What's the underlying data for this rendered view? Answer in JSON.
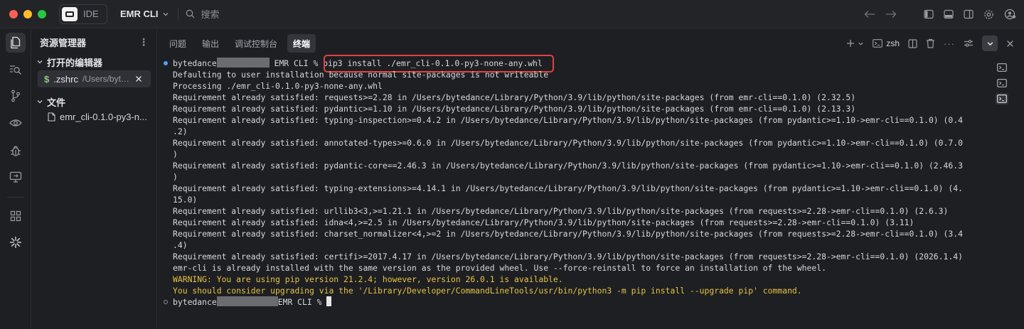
{
  "titlebar": {
    "app_label": "IDE",
    "project_name": "EMR CLI",
    "search_placeholder": "搜索"
  },
  "sidebar": {
    "title": "资源管理器",
    "open_editors_label": "打开的编辑器",
    "open_editor": {
      "name": ".zshrc",
      "path": "/Users/byt…"
    },
    "files_label": "文件",
    "files": [
      {
        "name": "emr_cli-0.1.0-py3-n..."
      }
    ]
  },
  "panel": {
    "tabs": [
      {
        "label": "问题",
        "active": false
      },
      {
        "label": "输出",
        "active": false
      },
      {
        "label": "调试控制台",
        "active": false
      },
      {
        "label": "终端",
        "active": true
      }
    ],
    "shell_label": "zsh"
  },
  "terminal": {
    "prompt_user": "bytedance",
    "prompt_suffix": " EMR CLI % ",
    "command": "pip3 install ./emr_cli-0.1.0-py3-none-any.whl",
    "output": [
      "Defaulting to user installation because normal site-packages is not writeable",
      "Processing ./emr_cli-0.1.0-py3-none-any.whl",
      "Requirement already satisfied: requests>=2.28 in /Users/bytedance/Library/Python/3.9/lib/python/site-packages (from emr-cli==0.1.0) (2.32.5)",
      "Requirement already satisfied: pydantic>=1.10 in /Users/bytedance/Library/Python/3.9/lib/python/site-packages (from emr-cli==0.1.0) (2.13.3)",
      "Requirement already satisfied: typing-inspection>=0.4.2 in /Users/bytedance/Library/Python/3.9/lib/python/site-packages (from pydantic>=1.10->emr-cli==0.1.0) (0.4",
      ".2)",
      "Requirement already satisfied: annotated-types>=0.6.0 in /Users/bytedance/Library/Python/3.9/lib/python/site-packages (from pydantic>=1.10->emr-cli==0.1.0) (0.7.0",
      ")",
      "Requirement already satisfied: pydantic-core==2.46.3 in /Users/bytedance/Library/Python/3.9/lib/python/site-packages (from pydantic>=1.10->emr-cli==0.1.0) (2.46.3",
      ")",
      "Requirement already satisfied: typing-extensions>=4.14.1 in /Users/bytedance/Library/Python/3.9/lib/python/site-packages (from pydantic>=1.10->emr-cli==0.1.0) (4.",
      "15.0)",
      "Requirement already satisfied: urllib3<3,>=1.21.1 in /Users/bytedance/Library/Python/3.9/lib/python/site-packages (from requests>=2.28->emr-cli==0.1.0) (2.6.3)",
      "Requirement already satisfied: idna<4,>=2.5 in /Users/bytedance/Library/Python/3.9/lib/python/site-packages (from requests>=2.28->emr-cli==0.1.0) (3.11)",
      "Requirement already satisfied: charset_normalizer<4,>=2 in /Users/bytedance/Library/Python/3.9/lib/python/site-packages (from requests>=2.28->emr-cli==0.1.0) (3.4",
      ".4)",
      "Requirement already satisfied: certifi>=2017.4.17 in /Users/bytedance/Library/Python/3.9/lib/python/site-packages (from requests>=2.28->emr-cli==0.1.0) (2026.1.4)",
      "emr-cli is already installed with the same version as the provided wheel. Use --force-reinstall to force an installation of the wheel."
    ],
    "warnings": [
      "WARNING: You are using pip version 21.2.4; however, version 26.0.1 is available.",
      "You should consider upgrading via the '/Library/Developer/CommandLineTools/usr/bin/python3 -m pip install --upgrade pip' command."
    ],
    "final_prompt_user": "bytedance",
    "final_prompt_suffix": "EMR CLI % "
  },
  "colors": {
    "background": "#1e1f22",
    "warning_text": "#e6c245",
    "highlight_box": "#e0443e",
    "prompt_dot": "#4ea1f3"
  }
}
